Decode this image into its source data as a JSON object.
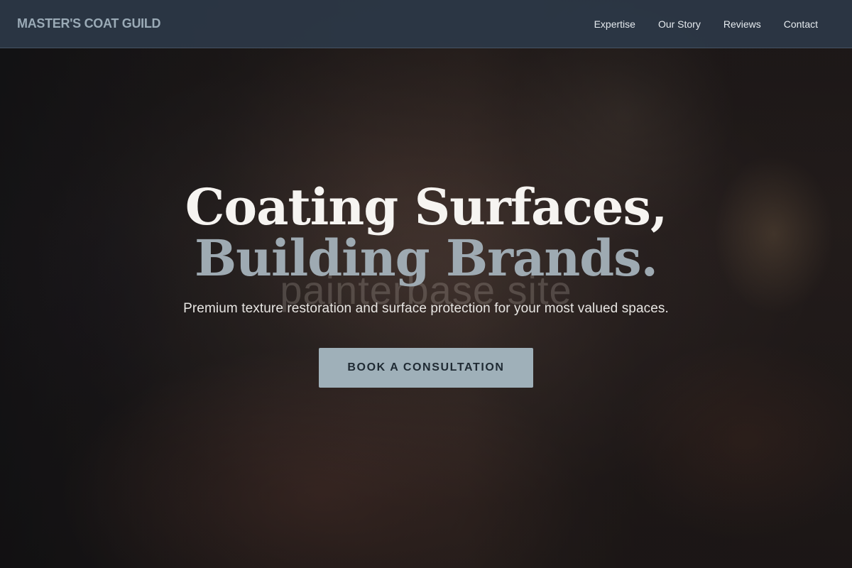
{
  "header": {
    "logo": "MASTER'S COAT GUILD",
    "nav": [
      {
        "label": "Expertise"
      },
      {
        "label": "Our Story"
      },
      {
        "label": "Reviews"
      },
      {
        "label": "Contact"
      }
    ]
  },
  "hero": {
    "headline_line1": "Coating Surfaces,",
    "headline_line2": "Building Brands.",
    "background_watermark": "painterbase site",
    "subtitle": "Premium texture restoration and surface protection for your most valued spaces.",
    "cta_label": "BOOK A CONSULTATION"
  },
  "colors": {
    "header_bg": "#2c3848",
    "logo": "#9aaab6",
    "accent": "#9fb0b9",
    "headline_primary": "#f6f4f1",
    "headline_secondary": "#9eaab2"
  }
}
